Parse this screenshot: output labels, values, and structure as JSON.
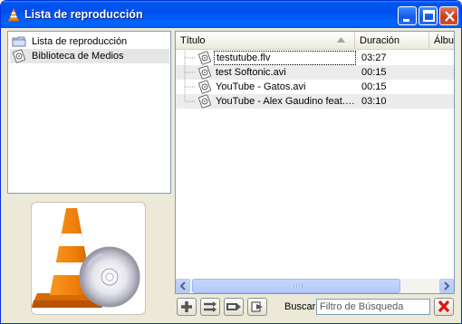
{
  "window": {
    "title": "Lista de reproducción",
    "accent": "#0055e5"
  },
  "sidebar": {
    "items": [
      {
        "label": "Lista de reproducción",
        "icon": "folder-icon",
        "selected": false
      },
      {
        "label": "Biblioteca de Medios",
        "icon": "media-library-icon",
        "selected": true
      }
    ]
  },
  "playlist": {
    "columns": [
      "Título",
      "Duración",
      "Álbum"
    ],
    "sorted_column": "Título",
    "rows": [
      {
        "title": "testutube.flv",
        "duration": "03:27"
      },
      {
        "title": "test Softonic.avi",
        "duration": "00:15"
      },
      {
        "title": "YouTube - Gatos.avi",
        "duration": "00:15"
      },
      {
        "title": "YouTube - Alex Gaudino feat. ...",
        "duration": "03:10"
      }
    ]
  },
  "toolbar": {
    "buttons": [
      "add-icon",
      "shuffle-icon",
      "repeat-icon",
      "sort-icon"
    ],
    "search_label": "Buscar",
    "search_placeholder": "Filtro de Búsqueda",
    "clear_icon": "red-x-icon"
  }
}
